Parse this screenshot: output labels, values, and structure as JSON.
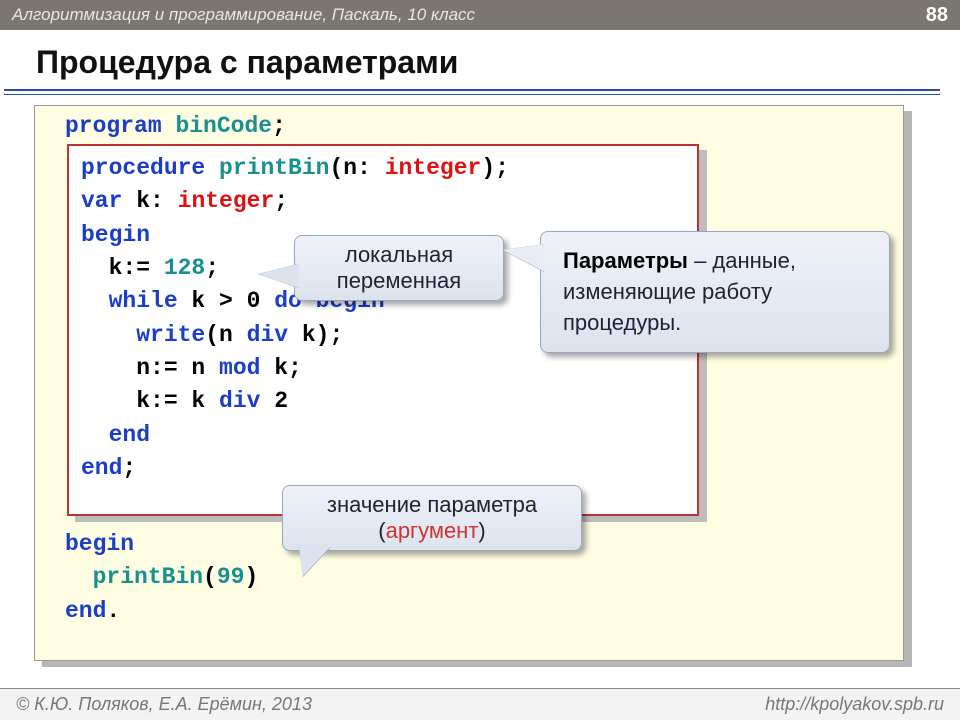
{
  "header": {
    "breadcrumb": "Алгоритмизация и программирование, Паскаль, 10 класс",
    "page_number": "88"
  },
  "title": "Процедура с параметрами",
  "code": {
    "program_kw": "program",
    "program_name": "binCode",
    "semicolon": ";",
    "procedure_kw": "procedure",
    "proc_name": "printBin",
    "open_paren": "(",
    "param_name": "n",
    "colon_sp": ": ",
    "type_integer": "integer",
    "close_paren_semi": ");",
    "var_kw": "var",
    "local_var": " k: ",
    "begin_kw": "begin",
    "line_k128_a": "  k:= ",
    "line_k128_b": "128",
    "line_k128_c": ";",
    "while_a": "  while",
    "while_b": " k > 0 ",
    "while_c": "do begin",
    "write_a": "    write",
    "write_b": "(n ",
    "write_div": "div",
    "write_c": " k);",
    "nmod_a": "    n:= n ",
    "nmod_kw": "mod",
    "nmod_b": " k;",
    "kdiv_a": "    k:= k ",
    "kdiv_kw": "div",
    "kdiv_b": " 2",
    "end1": "  end",
    "end2": "end",
    "main_begin": "begin",
    "call_indent": "  ",
    "call_name": "printBin",
    "call_open": "(",
    "call_arg": "99",
    "call_close": ")",
    "main_end": "end",
    "period": "."
  },
  "callouts": {
    "local_var": "локальная переменная",
    "params_bold": "Параметры",
    "params_rest": " – данные, изменяющие работу процедуры.",
    "arg_line1": "значение параметра",
    "arg_paren_open": "(",
    "arg_word": "аргумент",
    "arg_paren_close": ")"
  },
  "footer": {
    "copyright": "© К.Ю. Поляков, Е.А. Ерёмин, 2013",
    "url": "http://kpolyakov.spb.ru"
  }
}
